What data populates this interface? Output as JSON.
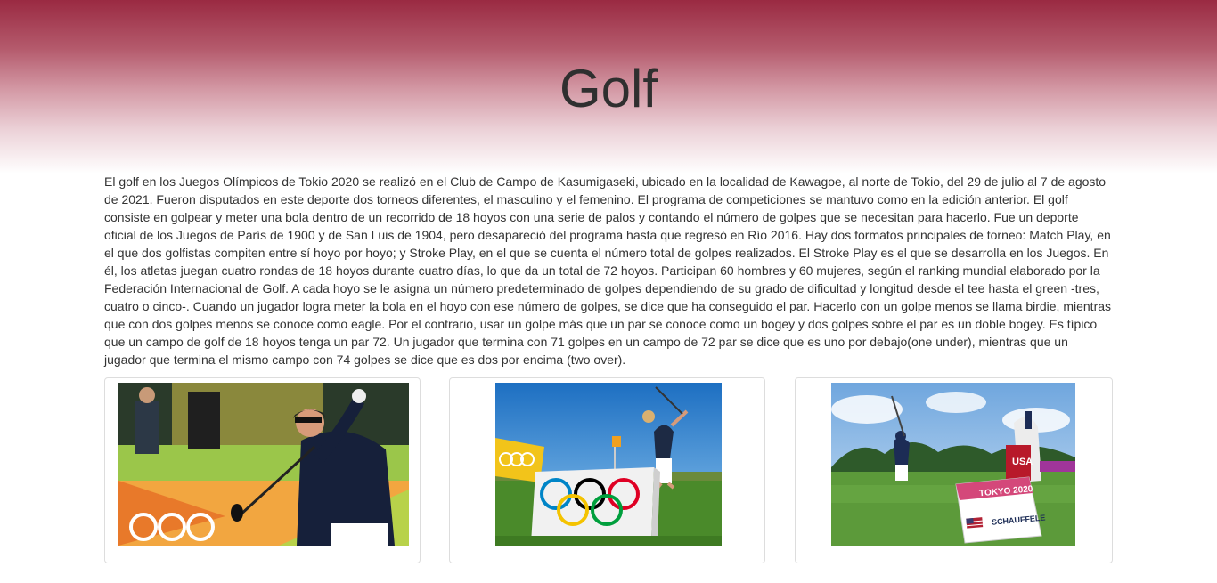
{
  "page": {
    "title": "Golf",
    "description": "El golf en los Juegos Olímpicos de Tokio 2020 se realizó en el Club de Campo de Kasumigaseki, ubicado en la localidad de Kawagoe, al norte de Tokio, del 29 de julio al 7 de agosto de 2021. Fueron disputados en este deporte dos torneos diferentes, el masculino y el femenino. El programa de competiciones se mantuvo como en la edición anterior. El golf consiste en golpear y meter una bola dentro de un recorrido de 18 hoyos con una serie de palos y contando el número de golpes que se necesitan para hacerlo. Fue un deporte oficial de los Juegos de París de 1900 y de San Luis de 1904, pero desapareció del programa hasta que regresó en Río 2016. Hay dos formatos principales de torneo: Match Play, en el que dos golfistas compiten entre sí hoyo por hoyo; y Stroke Play, en el que se cuenta el número total de golpes realizados. El Stroke Play es el que se desarrolla en los Juegos. En él, los atletas juegan cuatro rondas de 18 hoyos durante cuatro días, lo que da un total de 72 hoyos. Participan 60 hombres y 60 mujeres, según el ranking mundial elaborado por la Federación Internacional de Golf. A cada hoyo se le asigna un número predeterminado de golpes dependiendo de su grado de dificultad y longitud desde el tee hasta el green -tres, cuatro o cinco-. Cuando un jugador logra meter la bola en el hoyo con ese número de golpes, se dice que ha conseguido el par. Hacerlo con un golpe menos se llama birdie, mientras que con dos golpes menos se conoce como eagle. Por el contrario, usar un golpe más que un par se conoce como un bogey y dos golpes sobre el par es un doble bogey. Es típico que un campo de golf de 18 hoyos tenga un par 72. Un jugador que termina con 71 golpes en un campo de 72 par se dice que es uno por debajo(one under), mientras que un jugador que termina el mismo campo con 74 golpes se dice que es dos por encima (two over)."
  },
  "gallery": {
    "photo3_sign_event": "TOKYO 2020",
    "photo3_sign_name": "SCHAUFFELE",
    "photo3_bag_text": "USA"
  },
  "colors": {
    "header_top": "#9a2a42",
    "olympic_blue": "#0085c7",
    "olympic_yellow": "#f4c300",
    "olympic_black": "#000000",
    "olympic_green": "#009f3d",
    "olympic_red": "#df0024"
  }
}
